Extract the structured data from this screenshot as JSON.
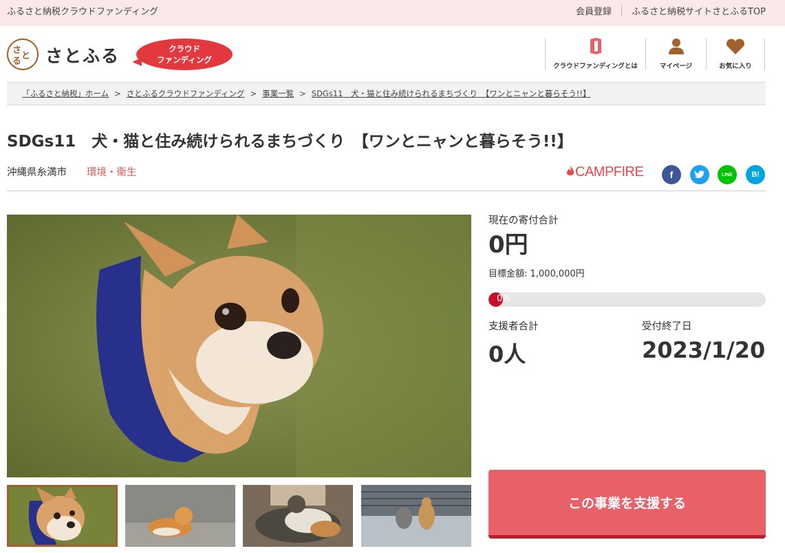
{
  "topbar": {
    "site_name": "ふるさと納税クラウドファンディング",
    "links": [
      "会員登録",
      "ふるさと納税サイトさとふるTOP"
    ]
  },
  "header": {
    "logo_mark": "さとふる",
    "logo_text": "さとふる",
    "badge_line1": "クラウド",
    "badge_line2": "ファンディング",
    "nav": [
      {
        "label": "クラウドファンディングとは",
        "icon": "book-icon"
      },
      {
        "label": "マイページ",
        "icon": "user-icon"
      },
      {
        "label": "お気に入り",
        "icon": "heart-icon"
      }
    ]
  },
  "breadcrumb": [
    "「ふるさと納税」ホーム",
    "さとふるクラウドファンディング",
    "事業一覧",
    "SDGs11　犬・猫と住み続けられるまちづくり　【ワンとニャンと暮らそう!!】"
  ],
  "project": {
    "title": "SDGs11　犬・猫と住み続けられるまちづくり　【ワンとニャンと暮らそう!!】",
    "location": "沖縄県糸満市",
    "category": "環境・衛生",
    "partner": "CAMPFIRE"
  },
  "share": [
    {
      "name": "facebook-icon",
      "glyph": "f",
      "color": "#3b5998"
    },
    {
      "name": "twitter-icon",
      "glyph": "t",
      "color": "#1da1f2"
    },
    {
      "name": "line-icon",
      "glyph": "LINE",
      "color": "#00c300"
    },
    {
      "name": "hatena-icon",
      "glyph": "B!",
      "color": "#00a4de"
    }
  ],
  "stats": {
    "total_label": "現在の寄付合計",
    "total_value": "0円",
    "goal_text": "目標金額: 1,000,000円",
    "progress_percent": 0,
    "progress_text": "0%",
    "supporters_label": "支援者合計",
    "supporters_value": "0人",
    "deadline_label": "受付終了日",
    "deadline_value": "2023/1/20"
  },
  "cta": {
    "label": "この事業を支援する"
  },
  "colors": {
    "accent": "#e86169",
    "brand_red": "#e4383f",
    "category": "#d95a5a"
  }
}
